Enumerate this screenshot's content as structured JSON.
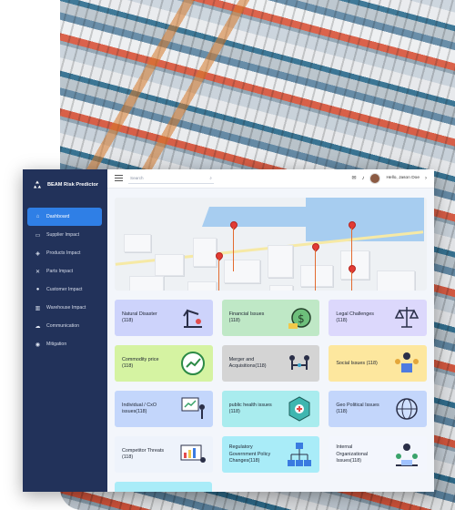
{
  "app": {
    "title": "BEAM Risk Predictor"
  },
  "sidebar": {
    "items": [
      {
        "label": "Dashboard",
        "icon": "home-icon",
        "active": true
      },
      {
        "label": "Supplier Impact",
        "icon": "truck-icon"
      },
      {
        "label": "Products Impact",
        "icon": "box-icon"
      },
      {
        "label": "Parts Impact",
        "icon": "tools-icon"
      },
      {
        "label": "Customer Impact",
        "icon": "user-icon"
      },
      {
        "label": "Warehouse Impact",
        "icon": "warehouse-icon"
      },
      {
        "label": "Communication",
        "icon": "chat-icon"
      },
      {
        "label": "Mitigation",
        "icon": "shield-icon"
      }
    ]
  },
  "topbar": {
    "search_placeholder": "Search",
    "greeting": "Hello, Jason Doe"
  },
  "cards": [
    {
      "label": "Natural Disaster (118)",
      "color": "#cdd3fb",
      "icon": "crane-icon"
    },
    {
      "label": "Financial Issues (118)",
      "color": "#bfe8c6",
      "icon": "money-bag-icon"
    },
    {
      "label": "Legal Challenges (118)",
      "color": "#dcd8fc",
      "icon": "scales-icon"
    },
    {
      "label": "Commodity price (118)",
      "color": "#d5f3a2",
      "icon": "price-chart-icon"
    },
    {
      "label": "Merger and Acquisitions(118)",
      "color": "#d4d4d4",
      "icon": "handshake-icon"
    },
    {
      "label": "Social Issues (118)",
      "color": "#fde79e",
      "icon": "people-icon"
    },
    {
      "label": "Individual / CxO issues(118)",
      "color": "#c3d6fb",
      "icon": "presentation-icon"
    },
    {
      "label": "public health issues (118)",
      "color": "#a9ecee",
      "icon": "medical-icon"
    },
    {
      "label": "Geo Political Issues (118)",
      "color": "#c3d6fb",
      "icon": "globe-icon"
    },
    {
      "label": "Competitor Threats (118)",
      "color": "#eef3fb",
      "icon": "dashboard-icon"
    },
    {
      "label": "Regulatory Government Policy Changes(118)",
      "color": "#a9ecf8",
      "icon": "org-chart-icon"
    },
    {
      "label": "Internal Organizational Issues(118)",
      "color": "#f3f6fd",
      "icon": "team-icon"
    }
  ]
}
